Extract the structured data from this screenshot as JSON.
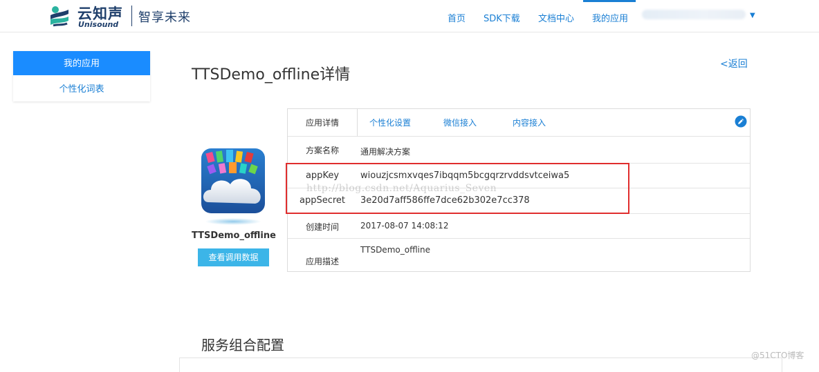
{
  "header": {
    "brand_cn": "云知声",
    "brand_en": "Unisound",
    "slogan": "智享未来",
    "nav": [
      {
        "label": "首页"
      },
      {
        "label": "SDK下载"
      },
      {
        "label": "文档中心"
      },
      {
        "label": "我的应用",
        "active": true
      }
    ],
    "logo_icon": "unisound-logo-icon",
    "caret_icon": "caret-down-icon"
  },
  "sidebar": {
    "items": [
      {
        "label": "我的应用",
        "active": true
      },
      {
        "label": "个性化词表"
      }
    ]
  },
  "main": {
    "title": "TTSDemo_offline详情",
    "back_label": "<返回",
    "app_card": {
      "name": "TTSDemo_offline",
      "button_label": "查看调用数据",
      "icon": "cloud-app-icon"
    },
    "tabs": [
      {
        "label": "应用详情",
        "active": true
      },
      {
        "label": "个性化设置"
      },
      {
        "label": "微信接入"
      },
      {
        "label": "内容接入"
      }
    ],
    "edit_icon": "edit-pencil-icon",
    "details": [
      {
        "label": "方案名称",
        "value": "通用解决方案"
      },
      {
        "label": "appKey",
        "value": "wiouzjcsmxvqes7ibqqm5bcgqrzrvddsvtceiwa5"
      },
      {
        "label": "appSecret",
        "value": "3e20d7aff586ffe7dce62b302e7cc378"
      },
      {
        "label": "创建时间",
        "value": "2017-08-07 14:08:12"
      },
      {
        "label": "应用描述",
        "value": "TTSDemo_offline"
      }
    ],
    "watermark": "http://blog.csdn.net/Aquarius_Seven",
    "section_title": "服务组合配置"
  },
  "corner_mark": "@51CTO博客",
  "colors": {
    "accent": "#1a7fd4",
    "sidebar_active": "#1a8cff",
    "button": "#3cb5e8",
    "highlight": "#e02d2d",
    "brand_navy": "#1f3f6b"
  }
}
